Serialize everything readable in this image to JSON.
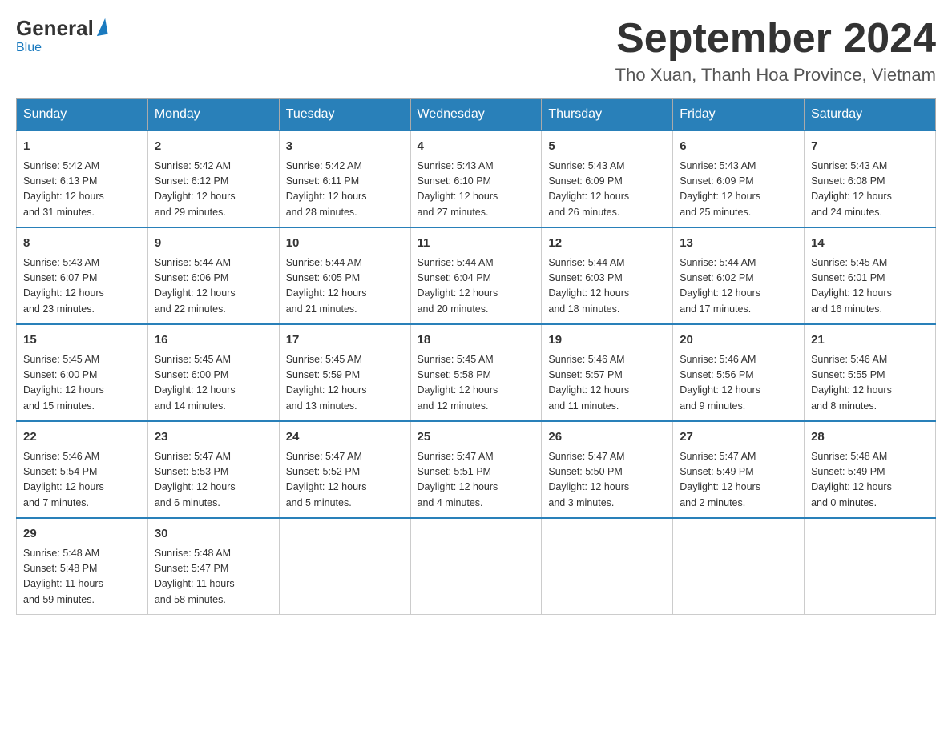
{
  "header": {
    "logo_general": "General",
    "logo_blue": "Blue",
    "month_title": "September 2024",
    "location": "Tho Xuan, Thanh Hoa Province, Vietnam"
  },
  "days_of_week": [
    "Sunday",
    "Monday",
    "Tuesday",
    "Wednesday",
    "Thursday",
    "Friday",
    "Saturday"
  ],
  "weeks": [
    [
      {
        "day": "1",
        "sunrise": "5:42 AM",
        "sunset": "6:13 PM",
        "daylight": "12 hours and 31 minutes."
      },
      {
        "day": "2",
        "sunrise": "5:42 AM",
        "sunset": "6:12 PM",
        "daylight": "12 hours and 29 minutes."
      },
      {
        "day": "3",
        "sunrise": "5:42 AM",
        "sunset": "6:11 PM",
        "daylight": "12 hours and 28 minutes."
      },
      {
        "day": "4",
        "sunrise": "5:43 AM",
        "sunset": "6:10 PM",
        "daylight": "12 hours and 27 minutes."
      },
      {
        "day": "5",
        "sunrise": "5:43 AM",
        "sunset": "6:09 PM",
        "daylight": "12 hours and 26 minutes."
      },
      {
        "day": "6",
        "sunrise": "5:43 AM",
        "sunset": "6:09 PM",
        "daylight": "12 hours and 25 minutes."
      },
      {
        "day": "7",
        "sunrise": "5:43 AM",
        "sunset": "6:08 PM",
        "daylight": "12 hours and 24 minutes."
      }
    ],
    [
      {
        "day": "8",
        "sunrise": "5:43 AM",
        "sunset": "6:07 PM",
        "daylight": "12 hours and 23 minutes."
      },
      {
        "day": "9",
        "sunrise": "5:44 AM",
        "sunset": "6:06 PM",
        "daylight": "12 hours and 22 minutes."
      },
      {
        "day": "10",
        "sunrise": "5:44 AM",
        "sunset": "6:05 PM",
        "daylight": "12 hours and 21 minutes."
      },
      {
        "day": "11",
        "sunrise": "5:44 AM",
        "sunset": "6:04 PM",
        "daylight": "12 hours and 20 minutes."
      },
      {
        "day": "12",
        "sunrise": "5:44 AM",
        "sunset": "6:03 PM",
        "daylight": "12 hours and 18 minutes."
      },
      {
        "day": "13",
        "sunrise": "5:44 AM",
        "sunset": "6:02 PM",
        "daylight": "12 hours and 17 minutes."
      },
      {
        "day": "14",
        "sunrise": "5:45 AM",
        "sunset": "6:01 PM",
        "daylight": "12 hours and 16 minutes."
      }
    ],
    [
      {
        "day": "15",
        "sunrise": "5:45 AM",
        "sunset": "6:00 PM",
        "daylight": "12 hours and 15 minutes."
      },
      {
        "day": "16",
        "sunrise": "5:45 AM",
        "sunset": "6:00 PM",
        "daylight": "12 hours and 14 minutes."
      },
      {
        "day": "17",
        "sunrise": "5:45 AM",
        "sunset": "5:59 PM",
        "daylight": "12 hours and 13 minutes."
      },
      {
        "day": "18",
        "sunrise": "5:45 AM",
        "sunset": "5:58 PM",
        "daylight": "12 hours and 12 minutes."
      },
      {
        "day": "19",
        "sunrise": "5:46 AM",
        "sunset": "5:57 PM",
        "daylight": "12 hours and 11 minutes."
      },
      {
        "day": "20",
        "sunrise": "5:46 AM",
        "sunset": "5:56 PM",
        "daylight": "12 hours and 9 minutes."
      },
      {
        "day": "21",
        "sunrise": "5:46 AM",
        "sunset": "5:55 PM",
        "daylight": "12 hours and 8 minutes."
      }
    ],
    [
      {
        "day": "22",
        "sunrise": "5:46 AM",
        "sunset": "5:54 PM",
        "daylight": "12 hours and 7 minutes."
      },
      {
        "day": "23",
        "sunrise": "5:47 AM",
        "sunset": "5:53 PM",
        "daylight": "12 hours and 6 minutes."
      },
      {
        "day": "24",
        "sunrise": "5:47 AM",
        "sunset": "5:52 PM",
        "daylight": "12 hours and 5 minutes."
      },
      {
        "day": "25",
        "sunrise": "5:47 AM",
        "sunset": "5:51 PM",
        "daylight": "12 hours and 4 minutes."
      },
      {
        "day": "26",
        "sunrise": "5:47 AM",
        "sunset": "5:50 PM",
        "daylight": "12 hours and 3 minutes."
      },
      {
        "day": "27",
        "sunrise": "5:47 AM",
        "sunset": "5:49 PM",
        "daylight": "12 hours and 2 minutes."
      },
      {
        "day": "28",
        "sunrise": "5:48 AM",
        "sunset": "5:49 PM",
        "daylight": "12 hours and 0 minutes."
      }
    ],
    [
      {
        "day": "29",
        "sunrise": "5:48 AM",
        "sunset": "5:48 PM",
        "daylight": "11 hours and 59 minutes."
      },
      {
        "day": "30",
        "sunrise": "5:48 AM",
        "sunset": "5:47 PM",
        "daylight": "11 hours and 58 minutes."
      },
      null,
      null,
      null,
      null,
      null
    ]
  ],
  "labels": {
    "sunrise": "Sunrise:",
    "sunset": "Sunset:",
    "daylight": "Daylight:"
  }
}
